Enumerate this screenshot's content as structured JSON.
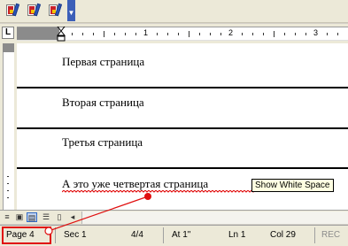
{
  "toolbar": {
    "buttons": [
      {
        "icon": "document-tool-icon-1"
      },
      {
        "icon": "document-tool-icon-2"
      },
      {
        "icon": "document-tool-icon-3"
      }
    ],
    "overflow_icon": "chevron-down-icon"
  },
  "ruler": {
    "tab_selector": "L",
    "numbers": [
      "1",
      "2",
      "3"
    ]
  },
  "document": {
    "pages": [
      "Первая страница",
      "Вторая страница",
      "Третья страница",
      "А это уже четвертая страница"
    ]
  },
  "tooltip": "Show White Space",
  "status_bar": {
    "page": "Page  4",
    "section": "Sec 1",
    "page_of": "4/4",
    "at": "At 1\"",
    "line": "Ln 1",
    "column": "Col 29",
    "rec": "REC"
  },
  "colors": {
    "annotation": "#e01010",
    "tooltip_bg": "#ffffe1",
    "chrome": "#ece9d8"
  }
}
